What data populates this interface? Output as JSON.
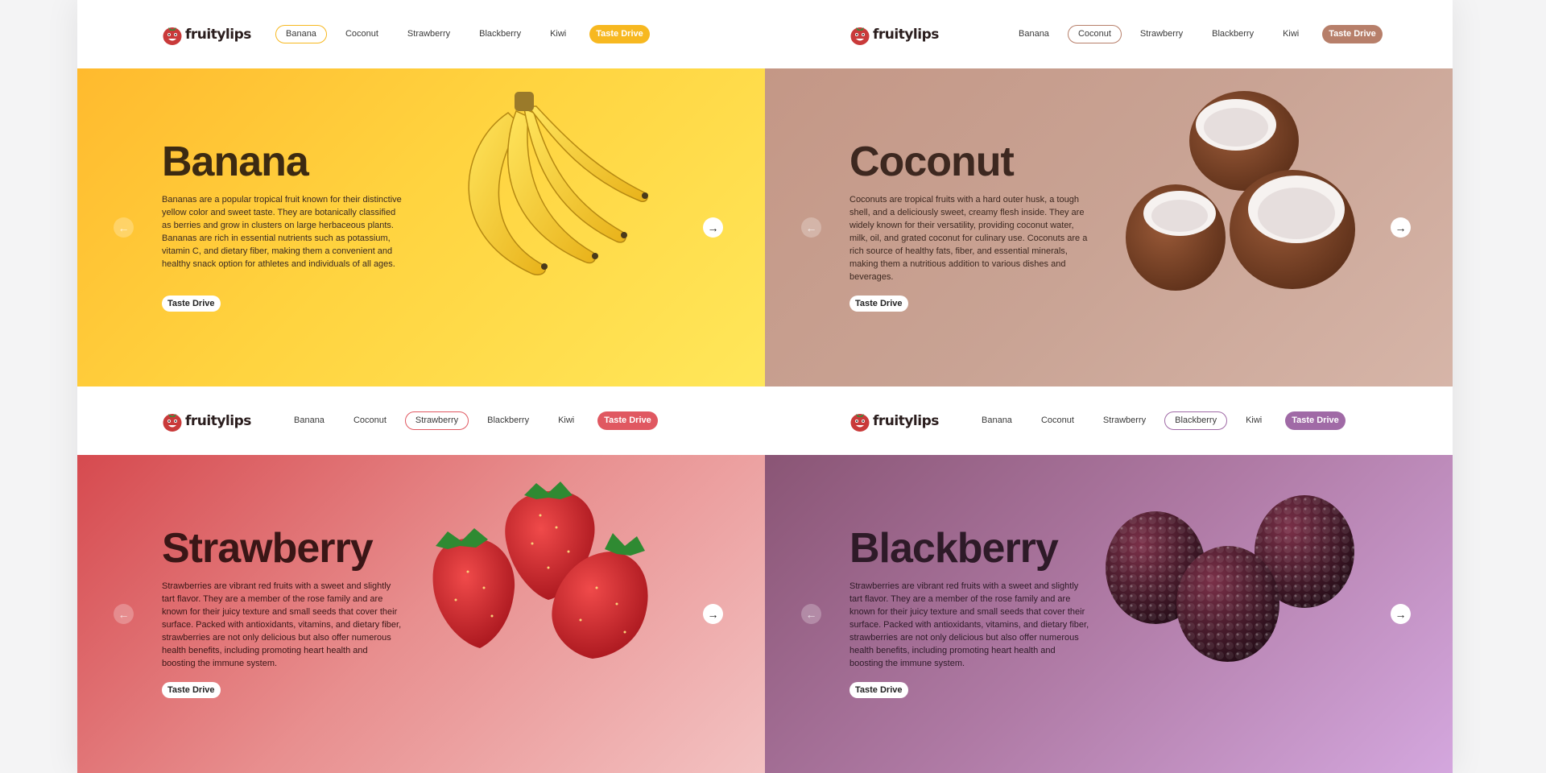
{
  "brand": {
    "name": "fruitylips",
    "icon": "tomato-face-logo"
  },
  "nav_items": [
    "Banana",
    "Coconut",
    "Strawberry",
    "Blackberry",
    "Kiwi"
  ],
  "nav_cta": "Taste Drive",
  "slider": {
    "prev_icon": "arrow-left-icon",
    "next_icon": "arrow-right-icon"
  },
  "panels": [
    {
      "active_tab": "Banana",
      "title": "Banana",
      "description": "Bananas are a popular tropical fruit known for their distinctive yellow color and sweet taste. They are botanically classified as berries and grow in clusters on large herbaceous plants. Bananas are rich in essential nutrients such as potassium, vitamin C, and dietary fiber, making them a convenient and healthy snack option for athletes and individuals of all ages.",
      "button": "Taste Drive",
      "accent": "#f7b820",
      "image": "banana-bunch"
    },
    {
      "active_tab": "Coconut",
      "title": "Coconut",
      "description": "Coconuts are tropical fruits with a hard outer husk, a tough shell, and a deliciously sweet, creamy flesh inside. They are widely known for their versatility, providing coconut water, milk, oil, and grated coconut for culinary use. Coconuts are a rich source of healthy fats, fiber, and essential minerals, making them a nutritious addition to various dishes and beverages.",
      "button": "Taste Drive",
      "accent": "#b77f6a",
      "image": "coconut-halves"
    },
    {
      "active_tab": "Strawberry",
      "title": "Strawberry",
      "description": "Strawberries are vibrant red fruits with a sweet and slightly tart flavor. They are a member of the rose family and are known for their juicy texture and small seeds that cover their surface. Packed with antioxidants, vitamins, and dietary fiber, strawberries are not only delicious but also offer numerous health benefits, including promoting heart health and boosting the immune system.",
      "button": "Taste Drive",
      "accent": "#e05861",
      "image": "strawberries"
    },
    {
      "active_tab": "Blackberry",
      "title": "Blackberry",
      "description": "Strawberries are vibrant red fruits with a sweet and slightly tart flavor. They are a member of the rose family and are known for their juicy texture and small seeds that cover their surface. Packed with antioxidants, vitamins, and dietary fiber, strawberries are not only delicious but also offer numerous health benefits, including promoting heart health and boosting the immune system.",
      "button": "Taste Drive",
      "accent": "#a06aa6",
      "image": "blackberries"
    }
  ]
}
